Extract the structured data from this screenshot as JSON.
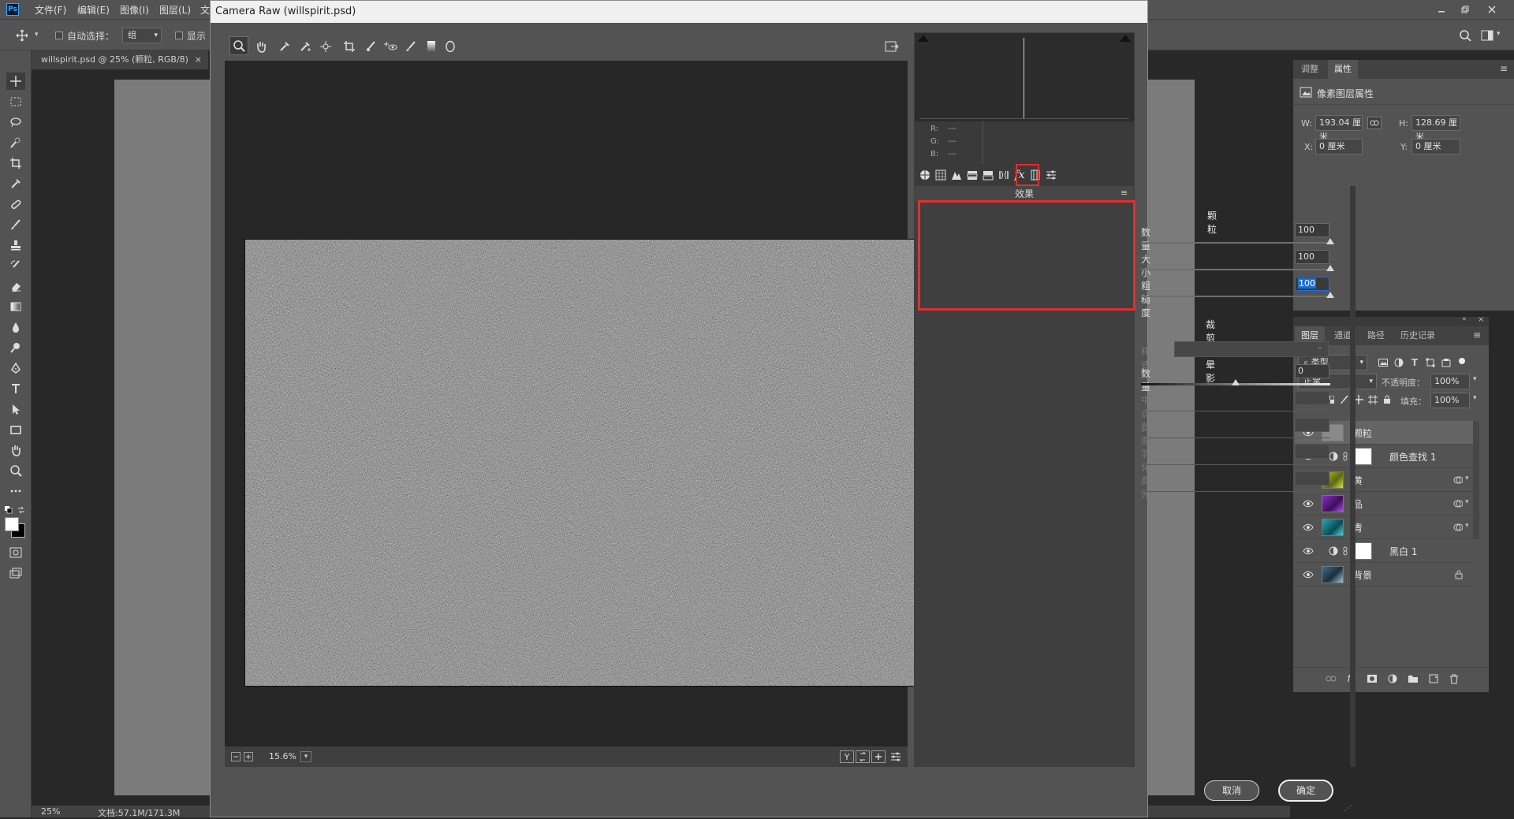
{
  "photoshop": {
    "menus": [
      "文件(F)",
      "编辑(E)",
      "图像(I)",
      "图层(L)",
      "文"
    ],
    "options": {
      "auto_select_label": "自动选择：",
      "auto_select_value": "组",
      "show_label": "显示"
    },
    "document_tab": "willspirit.psd @ 25% (颗粒, RGB/8)",
    "status_zoom": "25%",
    "status_doc": "文档:57.1M/171.3M"
  },
  "properties_panel": {
    "tabs": [
      "调整",
      "属性"
    ],
    "title": "像素图层属性",
    "w_label": "W:",
    "w_value": "193.04 厘米",
    "h_label": "H:",
    "h_value": "128.69 厘米",
    "x_label": "X:",
    "x_value": "0 厘米",
    "y_label": "Y:",
    "y_value": "0 厘米"
  },
  "layers_panel": {
    "tabs": [
      "图层",
      "通道",
      "路径",
      "历史记录"
    ],
    "filter_kind": "类型",
    "blend_mode": "正常",
    "opacity_label": "不透明度：",
    "opacity_value": "100%",
    "lock_label": "锁定：",
    "fill_label": "填充：",
    "fill_value": "100%",
    "layers": [
      {
        "name": "颗粒",
        "type": "pixel",
        "selected": true
      },
      {
        "name": "颜色查找 1",
        "type": "adjustment"
      },
      {
        "name": "黄",
        "type": "pixel",
        "color": "#b7c22a"
      },
      {
        "name": "品",
        "type": "pixel",
        "color": "#8b2dbf"
      },
      {
        "name": "青",
        "type": "pixel",
        "color": "#2aa6b4"
      },
      {
        "name": "黑白 1",
        "type": "adjustment"
      },
      {
        "name": "背景",
        "type": "pixel",
        "locked": true
      }
    ]
  },
  "camera_raw": {
    "title": "Camera Raw (willspirit.psd)",
    "rgb": {
      "r_label": "R:",
      "r_value": "---",
      "g_label": "G:",
      "g_value": "---",
      "b_label": "B:",
      "b_value": "---"
    },
    "panel_title": "效果",
    "grain": {
      "section_title": "颗粒",
      "amount_label": "数量",
      "amount_value": "100",
      "amount_level": 1.0,
      "size_label": "大小",
      "size_value": "100",
      "size_level": 1.0,
      "roughness_label": "粗糙度",
      "roughness_value": "100",
      "roughness_level": 1.0
    },
    "vignette": {
      "section_title": "裁剪后晕影",
      "style_label": "样式：",
      "amount_label": "数量",
      "amount_value": "0",
      "amount_level": 0.5,
      "midpoint_label": "中点",
      "roundness_label": "圆度",
      "feather_label": "羽化",
      "highlights_label": "高光"
    },
    "zoom_value": "15.6%",
    "cancel_label": "取消",
    "ok_label": "确定"
  },
  "colors": {
    "highlight_red": "#e03030",
    "selection_blue": "#1f6fd6"
  }
}
